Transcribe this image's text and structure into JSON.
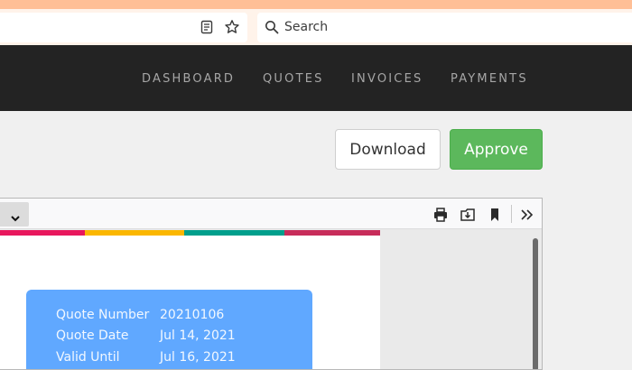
{
  "browser": {
    "search_placeholder": "Search",
    "accent_color": "#ffbf96",
    "icons": [
      "reader-view-icon",
      "bookmark-star-icon",
      "search-icon"
    ]
  },
  "nav": {
    "items": [
      {
        "label": "DASHBOARD"
      },
      {
        "label": "QUOTES"
      },
      {
        "label": "INVOICES"
      },
      {
        "label": "PAYMENTS"
      }
    ]
  },
  "actions": {
    "download_label": "Download",
    "approve_label": "Approve",
    "approve_color": "#5cb85c"
  },
  "pdf_viewer": {
    "toolbar_icons": [
      "print-icon",
      "save-icon",
      "bookmark-icon",
      "tools-menu-icon"
    ],
    "color_bar": [
      "#e8175d",
      "#fbb700",
      "#009f8c",
      "#c72c5a"
    ],
    "quote": {
      "rows": [
        {
          "label": "Quote Number",
          "value": "20210106"
        },
        {
          "label": "Quote Date",
          "value": "Jul 14, 2021"
        },
        {
          "label": "Valid Until",
          "value": "Jul 16, 2021"
        }
      ]
    }
  }
}
